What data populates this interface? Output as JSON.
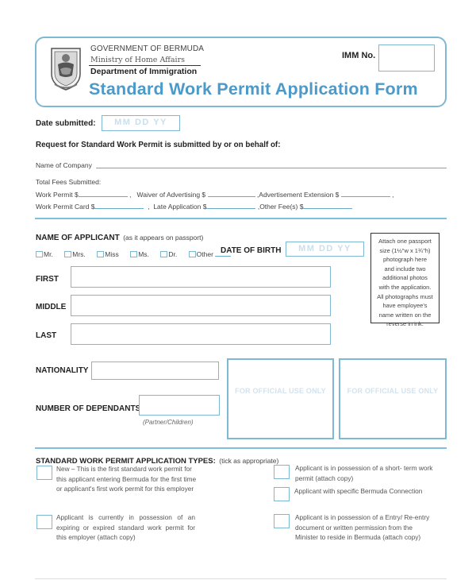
{
  "header": {
    "government": "GOVERNMENT OF BERMUDA",
    "ministry": "Ministry of Home Affairs",
    "department": "Department of Immigration",
    "title": "Standard Work Permit Application Form",
    "imm_label": "IMM No.",
    "imm_value": "",
    "crest_icon": "bermuda-coat-of-arms-icon"
  },
  "submission": {
    "date_label": "Date submitted:",
    "date_placeholder": "MM  DD  YY",
    "request_text": "Request for Standard Work Permit is submitted by or on behalf of:",
    "company_label": "Name of Company",
    "company_value": ""
  },
  "fees": {
    "heading": "Total Fees Submitted:",
    "row1": [
      {
        "label": "Work Permit $",
        "value": ""
      },
      {
        "label": "Waiver of Advertising $",
        "value": ""
      },
      {
        "label": "Advertisement Extension $",
        "value": ""
      }
    ],
    "row2": [
      {
        "label": "Work Permit Card  $",
        "value": ""
      },
      {
        "label": "Late Application $",
        "value": ""
      },
      {
        "label": "Other Fee(s)  $",
        "value": ""
      }
    ],
    "separator": ","
  },
  "applicant": {
    "heading": "NAME OF APPLICANT",
    "heading_note": "(as it appears on passport)",
    "titles": [
      "Mr.",
      "Mrs.",
      "Miss",
      "Ms.",
      "Dr.",
      "Other"
    ],
    "dob_label": "DATE OF BIRTH",
    "dob_placeholder": "MM  DD  YY",
    "first_label": "FIRST",
    "middle_label": "MIDDLE",
    "last_label": "LAST",
    "first_value": "",
    "middle_value": "",
    "last_value": "",
    "nationality_label": "NATIONALITY",
    "nationality_value": "",
    "dependants_label": "NUMBER OF DEPENDANTS",
    "dependants_value": "",
    "dependants_note": "(Partner/Children)"
  },
  "photo_instructions": [
    "Attach one passport",
    "size (1½\"w x 1¾\"h)",
    "photograph here",
    "and include two",
    "additional photos",
    "with the application.",
    "All photographs must",
    "have employee's",
    "name written on the",
    "reverse in ink."
  ],
  "official_use": [
    "FOR OFFICIAL USE ONLY",
    "FOR OFFICIAL USE ONLY"
  ],
  "application_types": {
    "heading": "STANDARD WORK PERMIT APPLICATION TYPES:",
    "heading_note": "(tick as appropriate)",
    "options": [
      {
        "text": "New – This is the first standard work permit for this applicant entering Bermuda for the first time or applicant's first work permit for this employer",
        "checked": false
      },
      {
        "text": "Applicant is in possession of a short- term work permit (attach copy)",
        "checked": false
      },
      {
        "text": "Applicant with specific Bermuda Connection",
        "checked": false
      },
      {
        "text": "Applicant is currently in possession of an expiring or expired standard work permit for this employer (attach copy)",
        "checked": false
      },
      {
        "text": "Applicant is in possession of a Entry/ Re-entry document or written permission from the Minister to reside in Bermuda (attach copy)",
        "checked": false
      }
    ]
  },
  "colors": {
    "accent": "#4b9ac9",
    "border": "#7fb8d2",
    "placeholder": "#c9dfec"
  }
}
